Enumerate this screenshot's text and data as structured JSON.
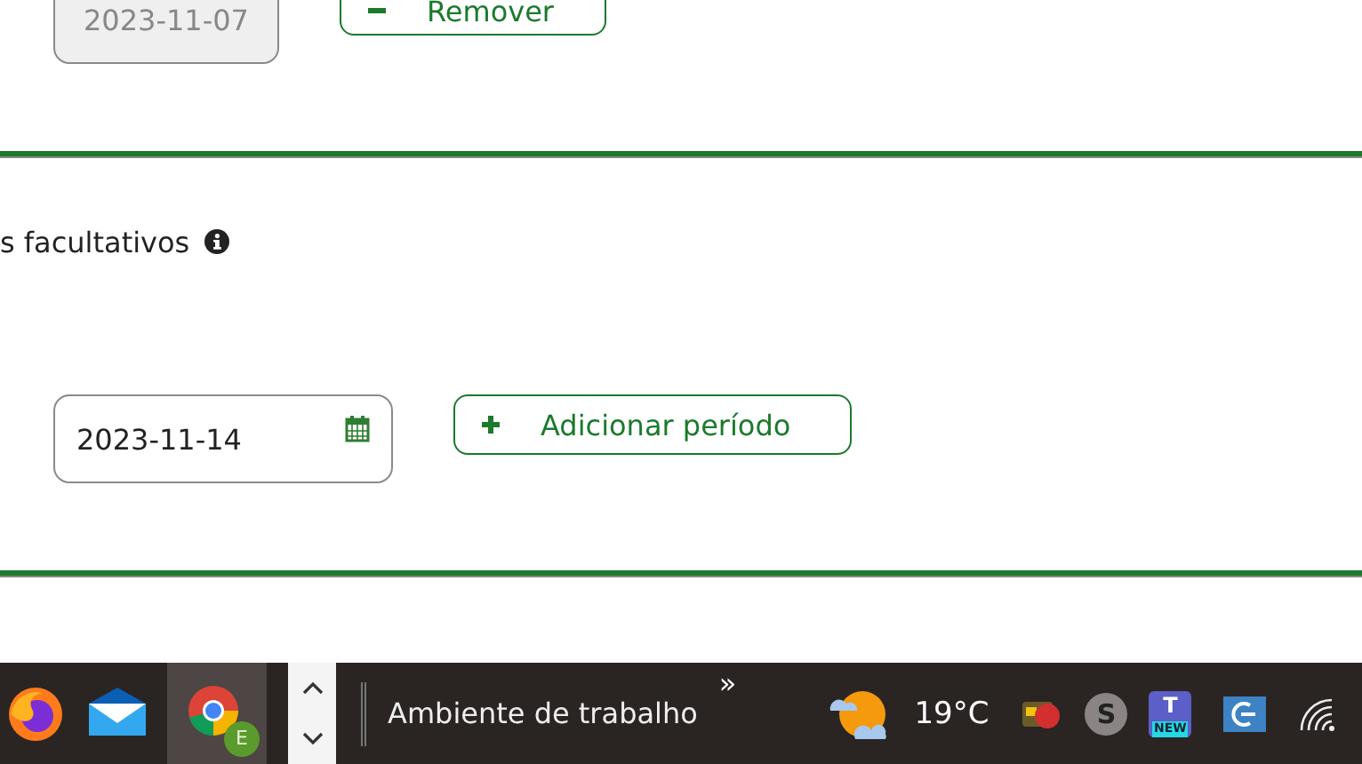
{
  "previous_row": {
    "date_field": {
      "value": "2023-11-07",
      "disabled": true
    },
    "button": {
      "kind": "remove",
      "label": "Remover"
    }
  },
  "section": {
    "label": "s facultativos",
    "date_field": {
      "value": "2023-11-14",
      "disabled": false
    },
    "button": {
      "kind": "add",
      "label": "Adicionar período"
    }
  },
  "taskbar": {
    "apps": [
      {
        "kind": "firefox",
        "selected": false
      },
      {
        "kind": "mail",
        "selected": false
      },
      {
        "kind": "chrome",
        "selected": true,
        "badge": "E"
      }
    ],
    "desktop_label": "Ambiente de trabalho",
    "overflow": "»",
    "temperature": "19°C",
    "tray": [
      {
        "kind": "stop"
      },
      {
        "kind": "skype",
        "letter": "S"
      },
      {
        "kind": "teams",
        "letter": "T",
        "badge": "NEW"
      },
      {
        "kind": "app"
      },
      {
        "kind": "wifi"
      }
    ]
  }
}
